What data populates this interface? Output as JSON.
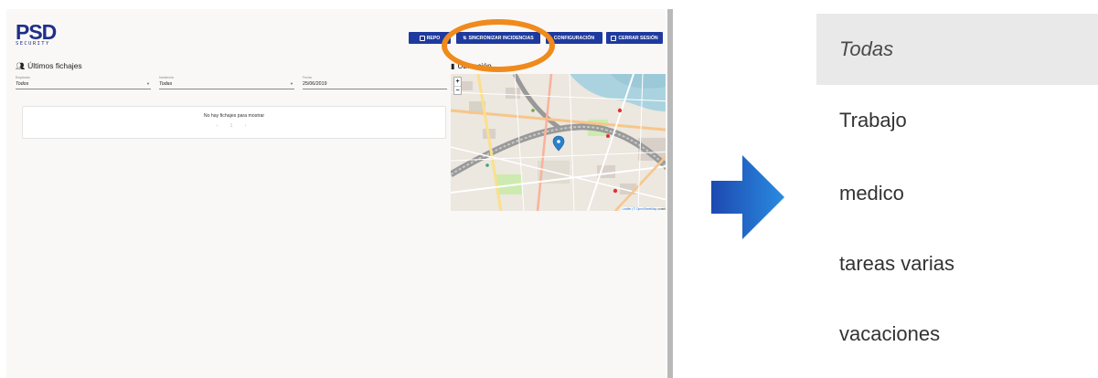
{
  "app": {
    "logo": {
      "brand": "PSD",
      "sub": "SECURITY"
    },
    "toolbar": {
      "reports_label": "REPO",
      "sync_label": "SINCRONIZAR INCIDENCIAS",
      "config_label": "CONFIGURACIÓN",
      "logout_label": "CERRAR SESIÓN"
    },
    "fichajes": {
      "title": "Últimos fichajes",
      "empleado_label": "Empleado",
      "empleado_value": "Todos",
      "incidencia_label": "Incidencia",
      "incidencia_value": "Todas",
      "fecha_label": "Fecha",
      "fecha_value": "25/06/2019",
      "empty_message": "No hay fichajes para mostrar",
      "pager": "‹ 1 ›"
    },
    "ubicacion": {
      "title": "Ubicación",
      "zoom_in": "+",
      "zoom_out": "−",
      "attribution_prefix": "Leaflet | © OpenStreetMap",
      "attribution_suffix": "contributors"
    }
  },
  "dropdown": {
    "options": [
      "Todas",
      "Trabajo",
      "medico",
      "tareas varias",
      "vacaciones"
    ],
    "selected": "Todas"
  },
  "colors": {
    "brand": "#1f2f8a",
    "button": "#1e3a9e",
    "highlight": "#f08a1c",
    "arrow": "#1e63c7"
  }
}
